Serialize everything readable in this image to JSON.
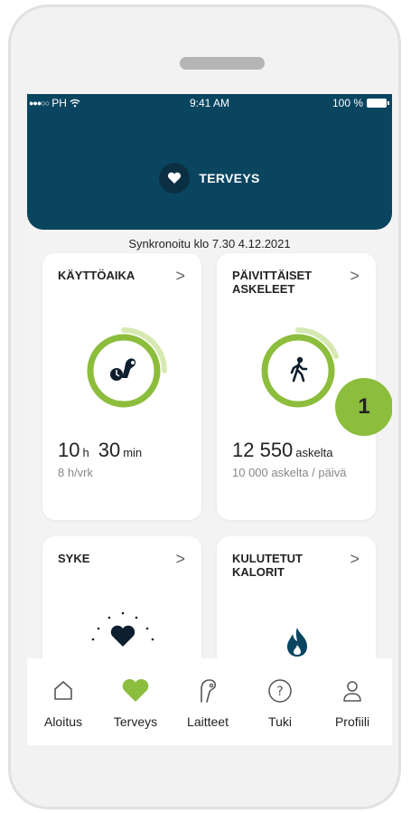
{
  "status_bar": {
    "carrier": "PH",
    "time": "9:41 AM",
    "battery": "100 %"
  },
  "header": {
    "title": "TERVEYS",
    "icon": "heart-icon"
  },
  "sync_text": "Synkronoitu klo 7.30 4.12.2021",
  "cards": {
    "usage": {
      "title": "KÄYTTÖAIKA",
      "hours": "10",
      "hours_unit": "h",
      "minutes": "30",
      "minutes_unit": "min",
      "goal": "8 h/vrk",
      "icon": "hearing-aid-icon",
      "progress": 1.1
    },
    "steps": {
      "title": "PÄIVITTÄISET ASKELEET",
      "value": "12 550",
      "unit": "askelta",
      "goal": "10 000 askelta / päivä",
      "icon": "walking-person-icon",
      "progress": 1.2
    },
    "heart_rate": {
      "title": "SYKE",
      "icon": "heart-rate-icon"
    },
    "calories": {
      "title": "KULUTETUT KALORIT",
      "icon": "flame-icon"
    }
  },
  "callout_marker": "1",
  "tabs": [
    {
      "label": "Aloitus",
      "icon": "home-icon"
    },
    {
      "label": "Terveys",
      "icon": "heart-icon",
      "active": true
    },
    {
      "label": "Laitteet",
      "icon": "hearing-aid-icon"
    },
    {
      "label": "Tuki",
      "icon": "help-icon"
    },
    {
      "label": "Profiili",
      "icon": "profile-icon"
    }
  ],
  "colors": {
    "header_bg": "#0a4560",
    "accent_green": "#8cbd3c",
    "flame_blue": "#0a4560"
  }
}
